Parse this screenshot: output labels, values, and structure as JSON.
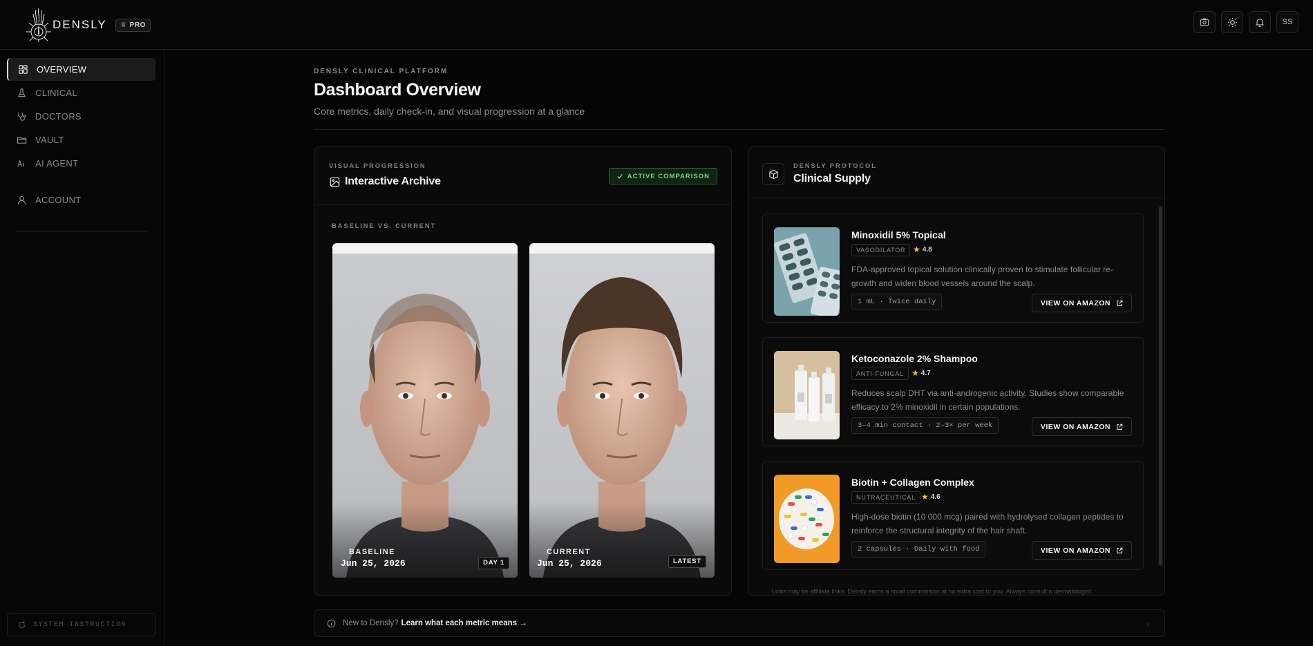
{
  "header": {
    "brand": "DENSLY",
    "pro_label": "PRO",
    "user_initials": "SS",
    "icons": [
      "camera-icon",
      "sun-icon",
      "bell-icon"
    ]
  },
  "sidebar": {
    "items": [
      {
        "label": "OVERVIEW",
        "icon": "grid-icon",
        "active": true
      },
      {
        "label": "CLINICAL",
        "icon": "flask-icon",
        "active": false
      },
      {
        "label": "DOCTORS",
        "icon": "stethoscope-icon",
        "active": false
      },
      {
        "label": "VAULT",
        "icon": "folder-icon",
        "active": false
      },
      {
        "label": "AI AGENT",
        "icon": "ai-icon",
        "active": false
      },
      {
        "label": "ACCOUNT",
        "icon": "user-icon",
        "active": false
      }
    ],
    "system_instruction": "SYSTEM INSTRUCTION"
  },
  "page": {
    "eyebrow": "DENSLY CLINICAL PLATFORM",
    "title": "Dashboard Overview",
    "subtitle": "Core metrics, daily check-in, and visual progression at a glance"
  },
  "archive": {
    "eyebrow": "VISUAL PROGRESSION",
    "title": "Interactive Archive",
    "badge": "ACTIVE COMPARISON",
    "section_label": "BASELINE VS. CURRENT",
    "baseline": {
      "label": "BASELINE",
      "date": "Jun 25, 2026",
      "tag": "DAY 1"
    },
    "current": {
      "label": "CURRENT",
      "date": "Jun 25, 2026",
      "tag": "LATEST"
    }
  },
  "supply": {
    "eyebrow": "DENSLY PROTOCOL",
    "title": "Clinical Supply",
    "products": [
      {
        "name": "Minoxidil 5% Topical",
        "category": "VASODILATOR",
        "rating": "4.8",
        "description": "FDA-approved topical solution clinically proven to stimulate follicular re-growth and widen blood vessels around the scalp.",
        "dose": "1 mL · Twice daily",
        "button": "VIEW ON AMAZON"
      },
      {
        "name": "Ketoconazole 2% Shampoo",
        "category": "ANTI-FUNGAL",
        "rating": "4.7",
        "description": "Reduces scalp DHT via anti-androgenic activity. Studies show comparable efficacy to 2% minoxidil in certain populations.",
        "dose": "3–4 min contact · 2–3× per week",
        "button": "VIEW ON AMAZON"
      },
      {
        "name": "Biotin + Collagen Complex",
        "category": "NUTRACEUTICAL",
        "rating": "4.6",
        "description": "High-dose biotin (10 000 mcg) paired with hydrolysed collagen peptides to reinforce the structural integrity of the hair shaft.",
        "dose": "2 capsules · Daily with food",
        "button": "VIEW ON AMAZON"
      }
    ],
    "disclaimer": "Links may be affiliate links. Densly earns a small commission at no extra cost to you. Always consult a dermatologist."
  },
  "footer": {
    "prefix": "New to Densly?",
    "link": "Learn what each metric means →"
  }
}
